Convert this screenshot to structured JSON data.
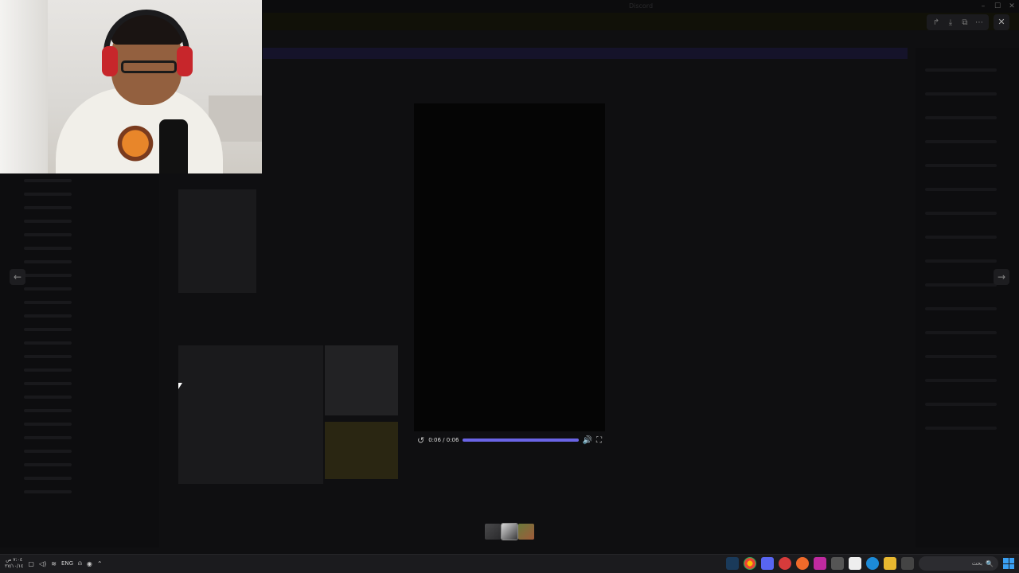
{
  "window": {
    "title": "Discord"
  },
  "viewer": {
    "prev_label": "←",
    "next_label": "→",
    "actions": [
      {
        "name": "forward-icon",
        "glyph": "↱"
      },
      {
        "name": "download-icon",
        "glyph": "⤓"
      },
      {
        "name": "open-external-icon",
        "glyph": "⧉"
      },
      {
        "name": "more-icon",
        "glyph": "⋯"
      }
    ],
    "close_glyph": "✕"
  },
  "player": {
    "time": "0:06 / 0:06",
    "progress": 1.0,
    "accent": "#6a64e6",
    "replay_glyph": "↺",
    "volume_glyph": "🔊",
    "fullscreen_glyph": "⛶"
  },
  "taskbar": {
    "time": "٧:٠٤ ص",
    "date": "٢٧/١٠/١٤",
    "language": "ENG",
    "search_placeholder": "بحث",
    "search_glyph": "🔍"
  }
}
